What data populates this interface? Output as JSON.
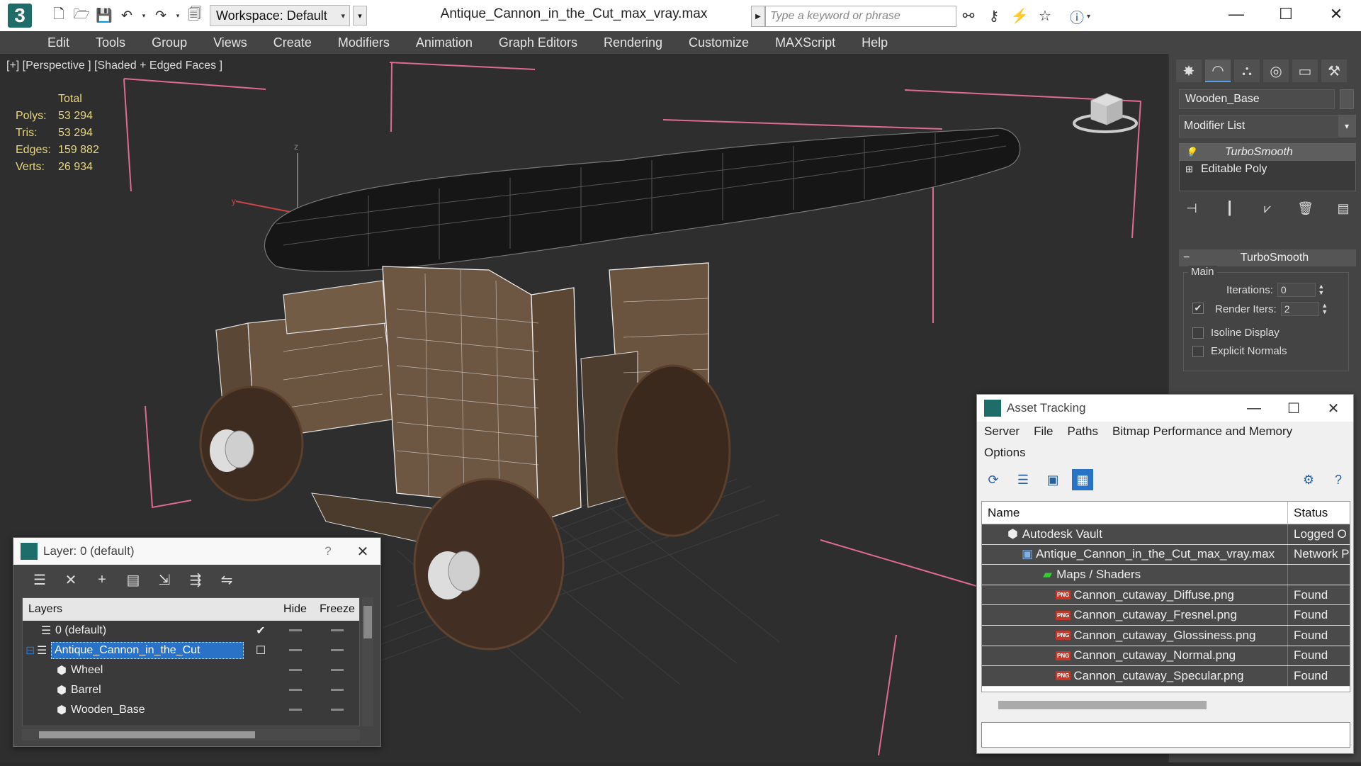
{
  "app": {
    "logo_letter": "3",
    "document_title": "Antique_Cannon_in_the_Cut_max_vray.max",
    "workspace_label": "Workspace: Default",
    "search_placeholder": "Type a keyword or phrase",
    "accent": "#1f6d6a"
  },
  "menu": [
    "Edit",
    "Tools",
    "Group",
    "Views",
    "Create",
    "Modifiers",
    "Animation",
    "Graph Editors",
    "Rendering",
    "Customize",
    "MAXScript",
    "Help"
  ],
  "viewport": {
    "label": "[+] [Perspective ] [Shaded + Edged Faces ]",
    "stats_header": "Total",
    "stats": [
      {
        "k": "Polys:",
        "v": "53 294"
      },
      {
        "k": "Tris:",
        "v": "53 294"
      },
      {
        "k": "Edges:",
        "v": "159 882"
      },
      {
        "k": "Verts:",
        "v": "26 934"
      }
    ],
    "stats_color": "#e8d67d"
  },
  "command_panel": {
    "object_name": "Wooden_Base",
    "modifier_list": "Modifier List",
    "stack": [
      "TurboSmooth",
      "Editable Poly"
    ],
    "rollout_title": "TurboSmooth",
    "group_main": "Main",
    "iterations_label": "Iterations:",
    "iterations_value": "0",
    "render_iters_label": "Render Iters:",
    "render_iters_value": "2",
    "render_iters_checked": true,
    "isoline_label": "Isoline Display",
    "explicit_label": "Explicit Normals"
  },
  "layer_window": {
    "title": "Layer: 0 (default)",
    "help": "?",
    "columns": {
      "layers": "Layers",
      "hide": "Hide",
      "freeze": "Freeze"
    },
    "rows": [
      {
        "name": "0 (default)",
        "indent": 1
      },
      {
        "name": "Antique_Cannon_in_the_Cut",
        "indent": 0
      },
      {
        "name": "Wheel",
        "indent": 2
      },
      {
        "name": "Barrel",
        "indent": 2
      },
      {
        "name": "Wooden_Base",
        "indent": 2
      }
    ]
  },
  "asset_window": {
    "title": "Asset Tracking",
    "menu": [
      "Server",
      "File",
      "Paths",
      "Bitmap Performance and Memory",
      "Options"
    ],
    "columns": {
      "name": "Name",
      "status": "Status"
    },
    "rows": [
      {
        "name": "Autodesk Vault",
        "status": "Logged O",
        "icon": "vault",
        "indent": 1
      },
      {
        "name": "Antique_Cannon_in_the_Cut_max_vray.max",
        "status": "Network P",
        "icon": "max",
        "indent": 2
      },
      {
        "name": "Maps / Shaders",
        "status": "",
        "icon": "maps",
        "indent": 3
      },
      {
        "name": "Cannon_cutaway_Diffuse.png",
        "status": "Found",
        "icon": "png",
        "indent": 4
      },
      {
        "name": "Cannon_cutaway_Fresnel.png",
        "status": "Found",
        "icon": "png",
        "indent": 4
      },
      {
        "name": "Cannon_cutaway_Glossiness.png",
        "status": "Found",
        "icon": "png",
        "indent": 4
      },
      {
        "name": "Cannon_cutaway_Normal.png",
        "status": "Found",
        "icon": "png",
        "indent": 4
      },
      {
        "name": "Cannon_cutaway_Specular.png",
        "status": "Found",
        "icon": "png",
        "indent": 4
      }
    ],
    "png_badge": "PNG"
  }
}
